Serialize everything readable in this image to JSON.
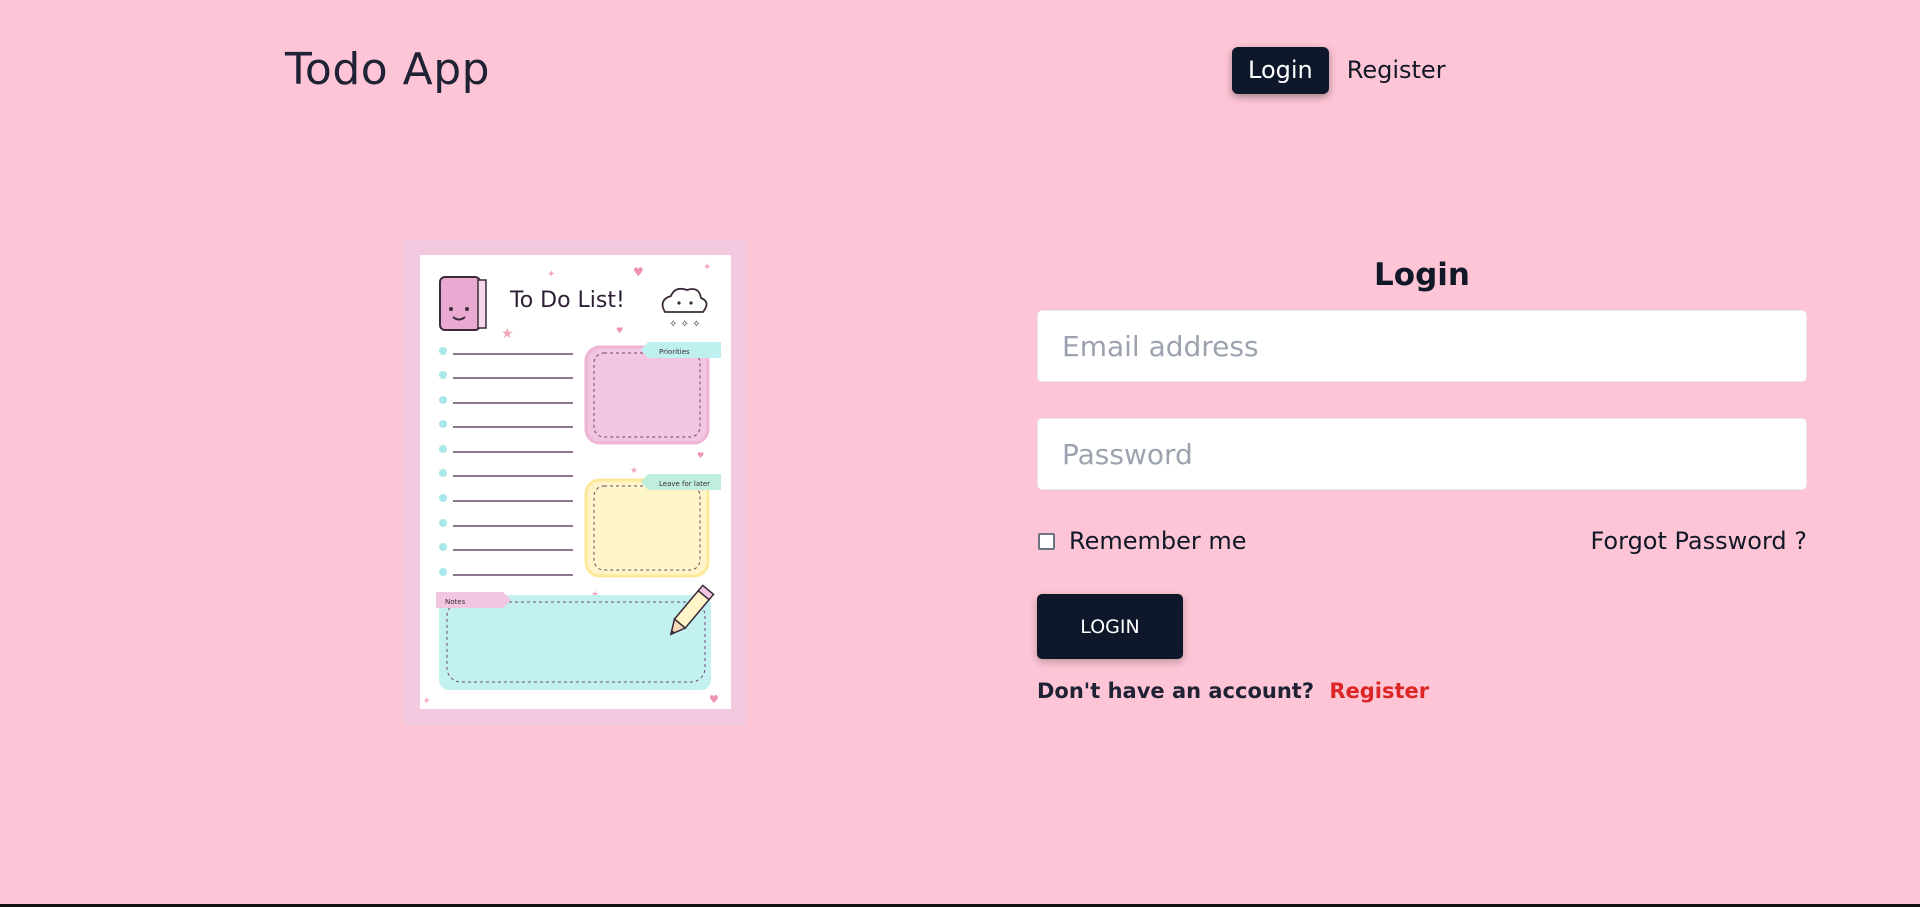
{
  "header": {
    "brand": "Todo App",
    "nav": {
      "login": "Login",
      "register": "Register"
    }
  },
  "illustration": {
    "title": "To Do List!",
    "priorities": "Priorities",
    "leave_for_later": "Leave for later",
    "notes": "Notes"
  },
  "form": {
    "title": "Login",
    "email_placeholder": "Email address",
    "password_placeholder": "Password",
    "remember_label": "Remember me",
    "forgot_password": "Forgot Password ?",
    "login_button": "LOGIN",
    "no_account": "Don't have an account?",
    "register_link": "Register"
  },
  "colors": {
    "background": "#fdc5d5",
    "primary": "#0f172a",
    "link": "#dc2626"
  }
}
